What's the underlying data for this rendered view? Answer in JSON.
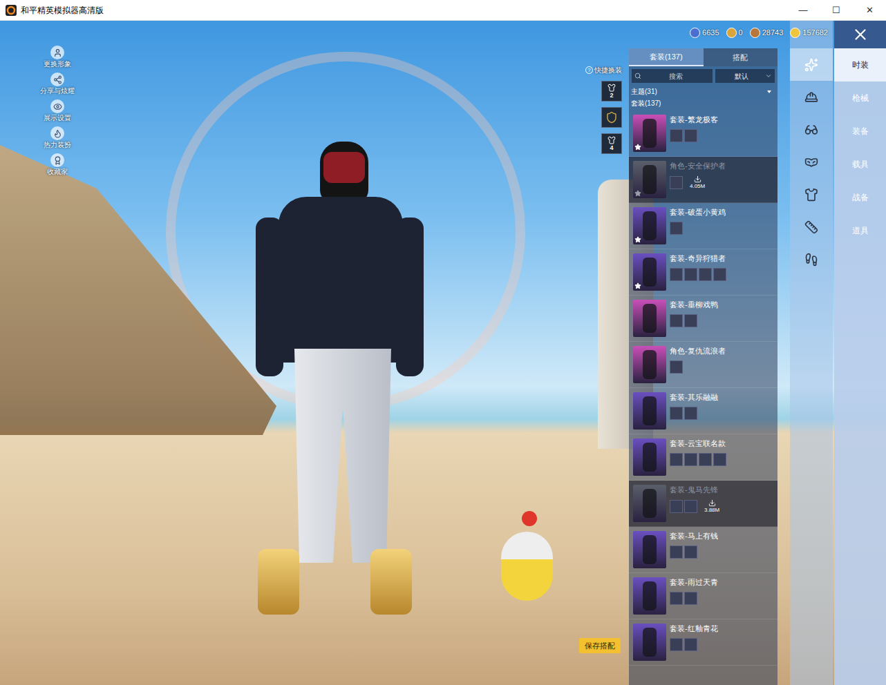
{
  "window": {
    "title": "和平精英模拟器高清版",
    "controls": [
      "—",
      "☐",
      "✕"
    ]
  },
  "scene_menu": [
    {
      "label": "更换形象"
    },
    {
      "label": "分享与炫耀"
    },
    {
      "label": "展示设置"
    },
    {
      "label": "热力装扮"
    },
    {
      "label": "收藏家"
    }
  ],
  "quick_change": {
    "help": "?",
    "label": "快捷换装",
    "slots": [
      {
        "kind": "slot",
        "label": "2"
      },
      {
        "kind": "emblem"
      },
      {
        "kind": "slot",
        "label": "4"
      }
    ]
  },
  "currencies": [
    {
      "value": "6635",
      "color": "#4a6fd1"
    },
    {
      "value": "0",
      "color": "#d9a53a"
    },
    {
      "value": "28743",
      "color": "#b7763a"
    },
    {
      "value": "157682",
      "color": "#f0c43c"
    }
  ],
  "panel": {
    "tabs": [
      {
        "label": "套装(137)",
        "selected": true
      },
      {
        "label": "搭配",
        "selected": false
      }
    ],
    "search": {
      "placeholder": "搜索"
    },
    "sort": {
      "value": "默认"
    },
    "filter": {
      "label": "主题(31)",
      "expanded": false
    },
    "section": "套装(137)",
    "items": [
      {
        "name": "套装-繁龙极客",
        "color": "#c94fb8",
        "starred": true,
        "downloading": false,
        "parts": 2
      },
      {
        "name": "角色-安全保护者",
        "color": "#5a5f6a",
        "starred": true,
        "downloading": true,
        "size": "4.05M",
        "parts": 1
      },
      {
        "name": "套装-破蛋小黄鸡",
        "color": "#6a4fc0",
        "starred": true,
        "downloading": false,
        "parts": 1
      },
      {
        "name": "套装-奇异狩猎者",
        "color": "#6a4fc0",
        "starred": true,
        "downloading": false,
        "parts": 4
      },
      {
        "name": "套装-垂柳戏鸭",
        "color": "#c94fb8",
        "starred": false,
        "downloading": false,
        "parts": 2
      },
      {
        "name": "角色-复仇流浪者",
        "color": "#c94fb8",
        "starred": false,
        "downloading": false,
        "parts": 1
      },
      {
        "name": "套装-其乐融融",
        "color": "#6a4fc0",
        "starred": false,
        "downloading": false,
        "parts": 2
      },
      {
        "name": "套装-云宝联名款",
        "color": "#6a4fc0",
        "starred": false,
        "downloading": false,
        "parts": 4
      },
      {
        "name": "套装-鬼马先锋",
        "color": "#5a5f6a",
        "starred": false,
        "downloading": true,
        "size": "3.88M",
        "parts": 2
      },
      {
        "name": "套装-马上有钱",
        "color": "#6a4fc0",
        "starred": false,
        "downloading": false,
        "parts": 2
      },
      {
        "name": "套装-雨过天青",
        "color": "#6a4fc0",
        "starred": false,
        "downloading": false,
        "parts": 2
      },
      {
        "name": "套装-红釉青花",
        "color": "#6a4fc0",
        "starred": false,
        "downloading": false,
        "parts": 2
      }
    ]
  },
  "categories": [
    {
      "selected": true
    },
    {
      "selected": false
    },
    {
      "selected": false
    },
    {
      "selected": false
    },
    {
      "selected": false
    },
    {
      "selected": false
    },
    {
      "selected": false
    }
  ],
  "nav": [
    {
      "label": "时装",
      "selected": true
    },
    {
      "label": "枪械",
      "selected": false
    },
    {
      "label": "装备",
      "selected": false
    },
    {
      "label": "载具",
      "selected": false
    },
    {
      "label": "战备",
      "selected": false
    },
    {
      "label": "道具",
      "selected": false
    }
  ],
  "save_button": "保存搭配"
}
